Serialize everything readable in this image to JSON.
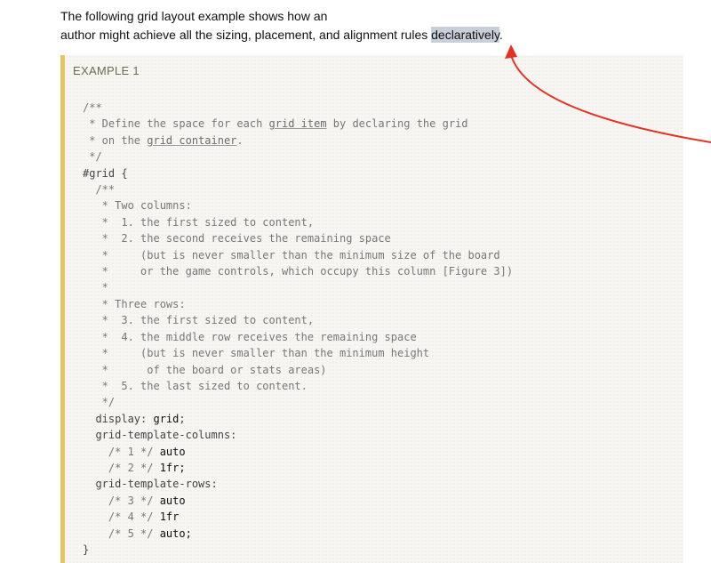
{
  "intro": {
    "line1": "The following grid layout example shows how an",
    "line2_before": "author might achieve all the sizing, placement, and alignment rules ",
    "line2_highlight": "declaratively",
    "line2_after": "."
  },
  "example": {
    "label": "EXAMPLE 1",
    "comment_open": "/**",
    "c1_a": " * Define the space for each ",
    "c1_link": "grid item",
    "c1_b": " by declaring the grid",
    "c2_a": " * on the ",
    "c2_link": "grid container",
    "c2_b": ".",
    "comment_close": " */",
    "selector": "#grid {",
    "inner_lines": [
      "  /**",
      "   * Two columns:",
      "   *  1. the first sized to content,",
      "   *  2. the second receives the remaining space",
      "   *     (but is never smaller than the minimum size of the board",
      "   *     or the game controls, which occupy this column [Figure 3])",
      "   *",
      "   * Three rows:",
      "   *  3. the first sized to content,",
      "   *  4. the middle row receives the remaining space",
      "   *     (but is never smaller than the minimum height",
      "   *      of the board or stats areas)",
      "   *  5. the last sized to content.",
      "   */"
    ],
    "display_prop": "  display: ",
    "display_val": "grid",
    "semicolon": ";",
    "cols_prop": "  grid-template-columns:",
    "col1_comment": "    /* 1 */ ",
    "col1_val": "auto",
    "col2_comment": "    /* 2 */ ",
    "col2_val": "1fr",
    "rows_prop": "  grid-template-rows:",
    "row3_comment": "    /* 3 */ ",
    "row3_val": "auto",
    "row4_comment": "    /* 4 */ ",
    "row4_val": "1fr",
    "row5_comment": "    /* 5 */ ",
    "row5_val": "auto",
    "close_brace": "}"
  },
  "colors": {
    "example_border": "#e2c760",
    "highlight": "#c9cfd8",
    "arrow": "#e53123"
  }
}
